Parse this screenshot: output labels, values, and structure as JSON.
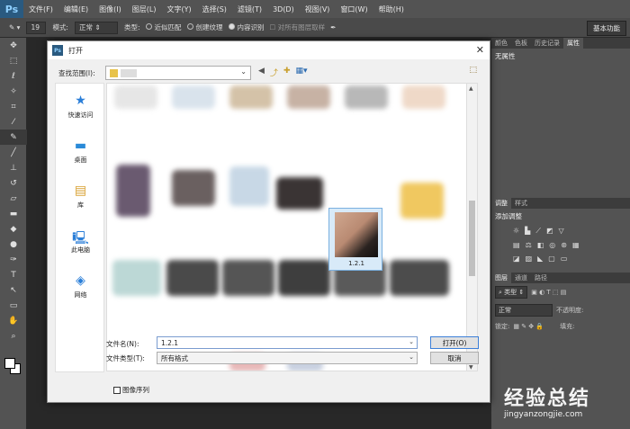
{
  "menubar": {
    "logo": "Ps",
    "items": [
      "文件(F)",
      "编辑(E)",
      "图像(I)",
      "图层(L)",
      "文字(Y)",
      "选择(S)",
      "滤镜(T)",
      "3D(D)",
      "视图(V)",
      "窗口(W)",
      "帮助(H)"
    ]
  },
  "options": {
    "brush_size": "19",
    "mode_label": "模式:",
    "mode_value": "正常",
    "type_label": "类型:",
    "radio1": "近似匹配",
    "radio2": "创建纹理",
    "radio3": "内容识别",
    "sample_all": "对所有图层取样",
    "workspace": "基本功能"
  },
  "panels": {
    "tabs1": [
      "颜色",
      "色板",
      "历史记录",
      "属性"
    ],
    "properties_text": "无属性",
    "tabs2": [
      "调整",
      "样式"
    ],
    "adjust_label": "添加调整",
    "tabs3": [
      "图层",
      "通道",
      "路径"
    ],
    "kind": "类型",
    "blend": "正常",
    "opacity_label": "不透明度:",
    "lock_label": "锁定:",
    "fill_label": "填充:"
  },
  "dialog": {
    "title": "打开",
    "lookin_label": "查找范围(I):",
    "places": [
      "快速访问",
      "桌面",
      "库",
      "此电脑",
      "网络"
    ],
    "selected_file": "1.2.1",
    "filename_label": "文件名(N):",
    "filename_value": "1.2.1",
    "filetype_label": "文件类型(T):",
    "filetype_value": "所有格式",
    "open_button": "打开(O)",
    "cancel_button": "取消",
    "sequence_label": "图像序列"
  },
  "watermark": {
    "cn": "经验总结",
    "en": "jingyanzongjie.com"
  }
}
